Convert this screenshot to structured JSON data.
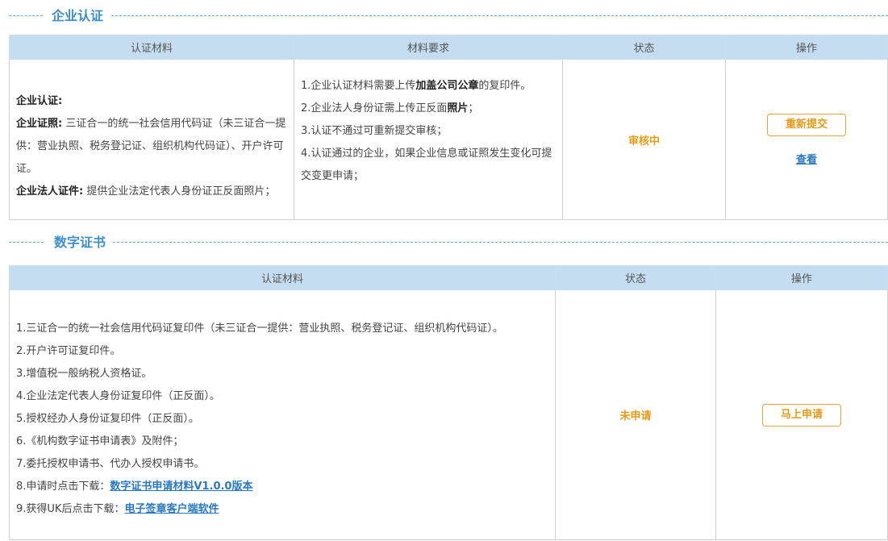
{
  "enterprise": {
    "section_title": "企业认证",
    "headers": [
      "认证材料",
      "材料要求",
      "状态",
      "操作"
    ],
    "materials": {
      "title": "企业认证:",
      "license_label": "企业证照:",
      "license_text": "三证合一的统一社会信用代码证（未三证合一提供：营业执照、税务登记证、组织机构代码证）、开户许可证。",
      "legal_label": "企业法人证件:",
      "legal_text": "提供企业法定代表人身份证正反面照片；"
    },
    "requirements": {
      "r1_a": "1.企业认证材料需要上传",
      "r1_b": "加盖公司公章",
      "r1_c": "的复印件。",
      "r2_a": "2.企业法人身份证需上传正反面",
      "r2_b": "照片",
      "r2_c": "；",
      "r3": "3.认证不通过可重新提交审核；",
      "r4": "4.认证通过的企业，如果企业信息或证照发生变化可提交变更申请；"
    },
    "status": "审核中",
    "resubmit_label": "重新提交",
    "view_label": "查看"
  },
  "certificate": {
    "section_title": "数字证书",
    "headers": [
      "认证材料",
      "状态",
      "操作"
    ],
    "items": [
      "1.三证合一的统一社会信用代码证复印件（未三证合一提供：营业执照、税务登记证、组织机构代码证）。",
      "2.开户许可证复印件。",
      "3.增值税一般纳税人资格证。",
      "4.企业法定代表人身份证复印件（正反面）。",
      "5.授权经办人身份证复印件（正反面）。",
      "6.《机构数字证书申请表》及附件；",
      "7.委托授权申请书、代办人授权申请书。"
    ],
    "item8_prefix": "8.申请时点击下载：",
    "item8_link": "数字证书申请材料V1.0.0版本",
    "item9_prefix": "9.获得UK后点击下载：",
    "item9_link": "电子签章客户端软件",
    "status": "未申请",
    "apply_label": "马上申请"
  }
}
